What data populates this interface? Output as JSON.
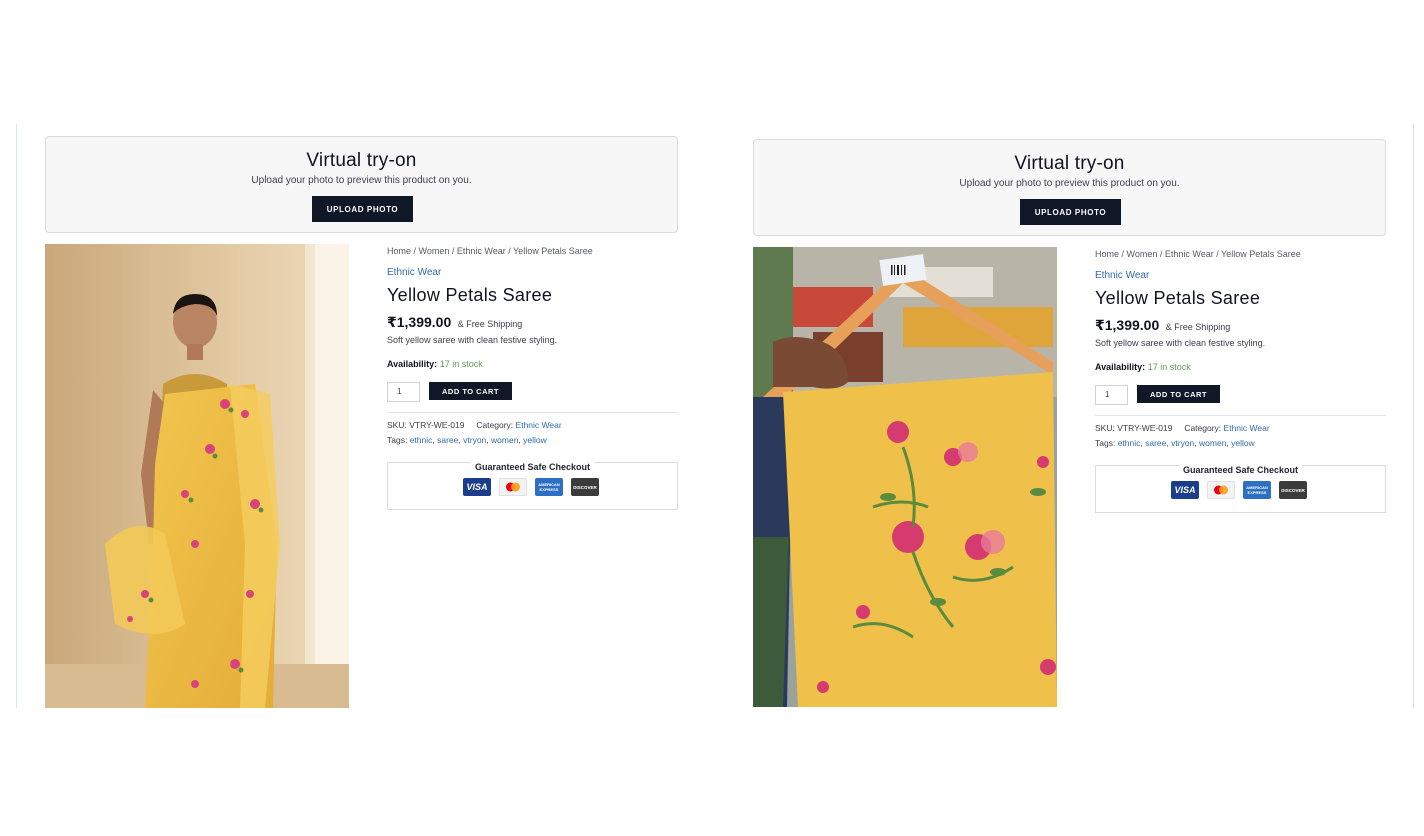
{
  "tryon": {
    "title": "Virtual try-on",
    "subtitle": "Upload your photo to preview this product on you.",
    "upload_label": "UPLOAD PHOTO"
  },
  "product": {
    "breadcrumb": "Home / Women / Ethnic Wear / Yellow Petals Saree",
    "category": "Ethnic Wear",
    "title": "Yellow Petals Saree",
    "price": "₹1,399.00",
    "shipping": "& Free Shipping",
    "description": "Soft yellow saree with clean festive styling.",
    "availability_label": "Availability:",
    "availability_value": "17 in stock",
    "quantity": "1",
    "add_to_cart_label": "ADD TO CART",
    "sku_label": "SKU:",
    "sku_value": "VTRY-WE-019",
    "category_label": "Category:",
    "category_value": "Ethnic Wear",
    "tags_label": "Tags:",
    "tags": [
      "ethnic",
      "saree",
      "vtryon",
      "women",
      "yellow"
    ],
    "checkout_title": "Guaranteed Safe Checkout",
    "payment_cards": [
      {
        "name": "VISA",
        "icon": "visa-card-icon"
      },
      {
        "name": "Mastercard",
        "icon": "mastercard-icon"
      },
      {
        "name": "AMERICAN EXPRESS",
        "icon": "amex-card-icon"
      },
      {
        "name": "DISCOVER",
        "icon": "discover-card-icon"
      }
    ]
  },
  "colors": {
    "dark_button": "#101828",
    "link": "#2f6cae",
    "in_stock": "#5f9e4f",
    "saree_yellow": "#f0c14a"
  }
}
